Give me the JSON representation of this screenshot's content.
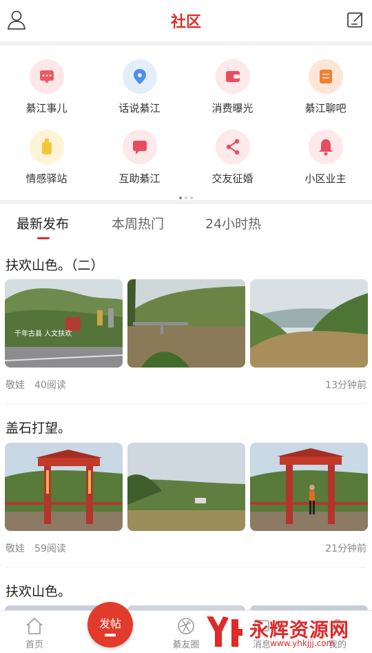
{
  "header": {
    "title": "社区"
  },
  "categories": [
    {
      "label": "綦江事儿",
      "color": "#ec5a64",
      "bg": "#fde7e7",
      "icon": "chat-icon"
    },
    {
      "label": "话说綦江",
      "color": "#4d8ff0",
      "bg": "#e4eefb",
      "icon": "location-icon"
    },
    {
      "label": "消费曝光",
      "color": "#e84d5e",
      "bg": "#fde8ea",
      "icon": "wallet-icon"
    },
    {
      "label": "綦江聊吧",
      "color": "#f08032",
      "bg": "#fde6d6",
      "icon": "note-icon"
    },
    {
      "label": "情感驿站",
      "color": "#f3c63a",
      "bg": "#fdf3d6",
      "icon": "bottle-icon"
    },
    {
      "label": "互助綦江",
      "color": "#e84d5e",
      "bg": "#fde8ea",
      "icon": "message-icon"
    },
    {
      "label": "交友征婚",
      "color": "#e84d5e",
      "bg": "#fde8ea",
      "icon": "share-icon"
    },
    {
      "label": "小区业主",
      "color": "#e84d5e",
      "bg": "#fde8ea",
      "icon": "bell-icon"
    }
  ],
  "tabs": [
    {
      "label": "最新发布",
      "active": true
    },
    {
      "label": "本周热门",
      "active": false
    },
    {
      "label": "24小时热",
      "active": false
    }
  ],
  "posts": [
    {
      "title": "扶欢山色。（二）",
      "author": "敬娃",
      "reads": "40阅读",
      "time": "13分钟前"
    },
    {
      "title": "盖石打望。",
      "author": "敬娃",
      "reads": "59阅读",
      "time": "21分钟前"
    },
    {
      "title": "扶欢山色。"
    }
  ],
  "photo_captions": {
    "sign": "千年古县 人文扶欢"
  },
  "fab": {
    "label": "发帖"
  },
  "bottom_nav": [
    {
      "label": "首页"
    },
    {
      "label": "綦友圈"
    },
    {
      "label": "消息"
    },
    {
      "label": "我的"
    }
  ],
  "watermark": {
    "text": "永辉资源网",
    "url": "www.yhkjjj.com"
  }
}
